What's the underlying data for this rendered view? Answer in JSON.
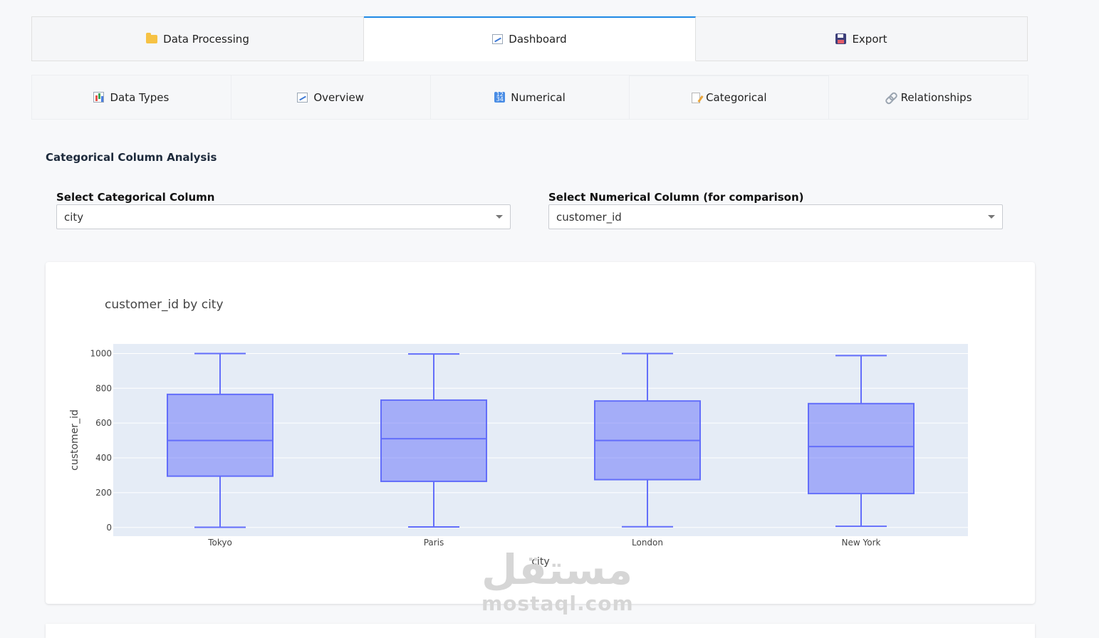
{
  "main_tabs": [
    {
      "label": "Data Processing",
      "icon": "folder-icon"
    },
    {
      "label": "Dashboard",
      "icon": "chart-icon",
      "active": true
    },
    {
      "label": "Export",
      "icon": "floppy-disk-icon"
    }
  ],
  "sub_tabs": [
    {
      "label": "Data Types",
      "icon": "bar-chart-icon"
    },
    {
      "label": "Overview",
      "icon": "chart-icon"
    },
    {
      "label": "Numerical",
      "icon": "numbers-icon"
    },
    {
      "label": "Categorical",
      "icon": "memo-icon",
      "active": true
    },
    {
      "label": "Relationships",
      "icon": "link-icon"
    }
  ],
  "section_title": "Categorical Column Analysis",
  "controls": {
    "categorical_label": "Select Categorical Column",
    "categorical_value": "city",
    "numerical_label": "Select Numerical Column (for comparison)",
    "numerical_value": "customer_id"
  },
  "chart_data": {
    "type": "box",
    "title": "customer_id by city",
    "xlabel": "city",
    "ylabel": "customer_id",
    "ylim": [
      -50,
      1055
    ],
    "yticks": [
      0,
      200,
      400,
      600,
      800,
      1000
    ],
    "grid": true,
    "color": "#636efa",
    "boxes": [
      {
        "category": "Tokyo",
        "min": 1,
        "q1": 295,
        "median": 500,
        "q3": 765,
        "max": 1000
      },
      {
        "category": "Paris",
        "min": 3,
        "q1": 265,
        "median": 510,
        "q3": 732,
        "max": 997
      },
      {
        "category": "London",
        "min": 4,
        "q1": 275,
        "median": 500,
        "q3": 727,
        "max": 1000
      },
      {
        "category": "New York",
        "min": 7,
        "q1": 195,
        "median": 465,
        "q3": 712,
        "max": 988
      }
    ]
  },
  "watermark": {
    "arabic": "مستقل",
    "latin": "mostaql.com"
  }
}
